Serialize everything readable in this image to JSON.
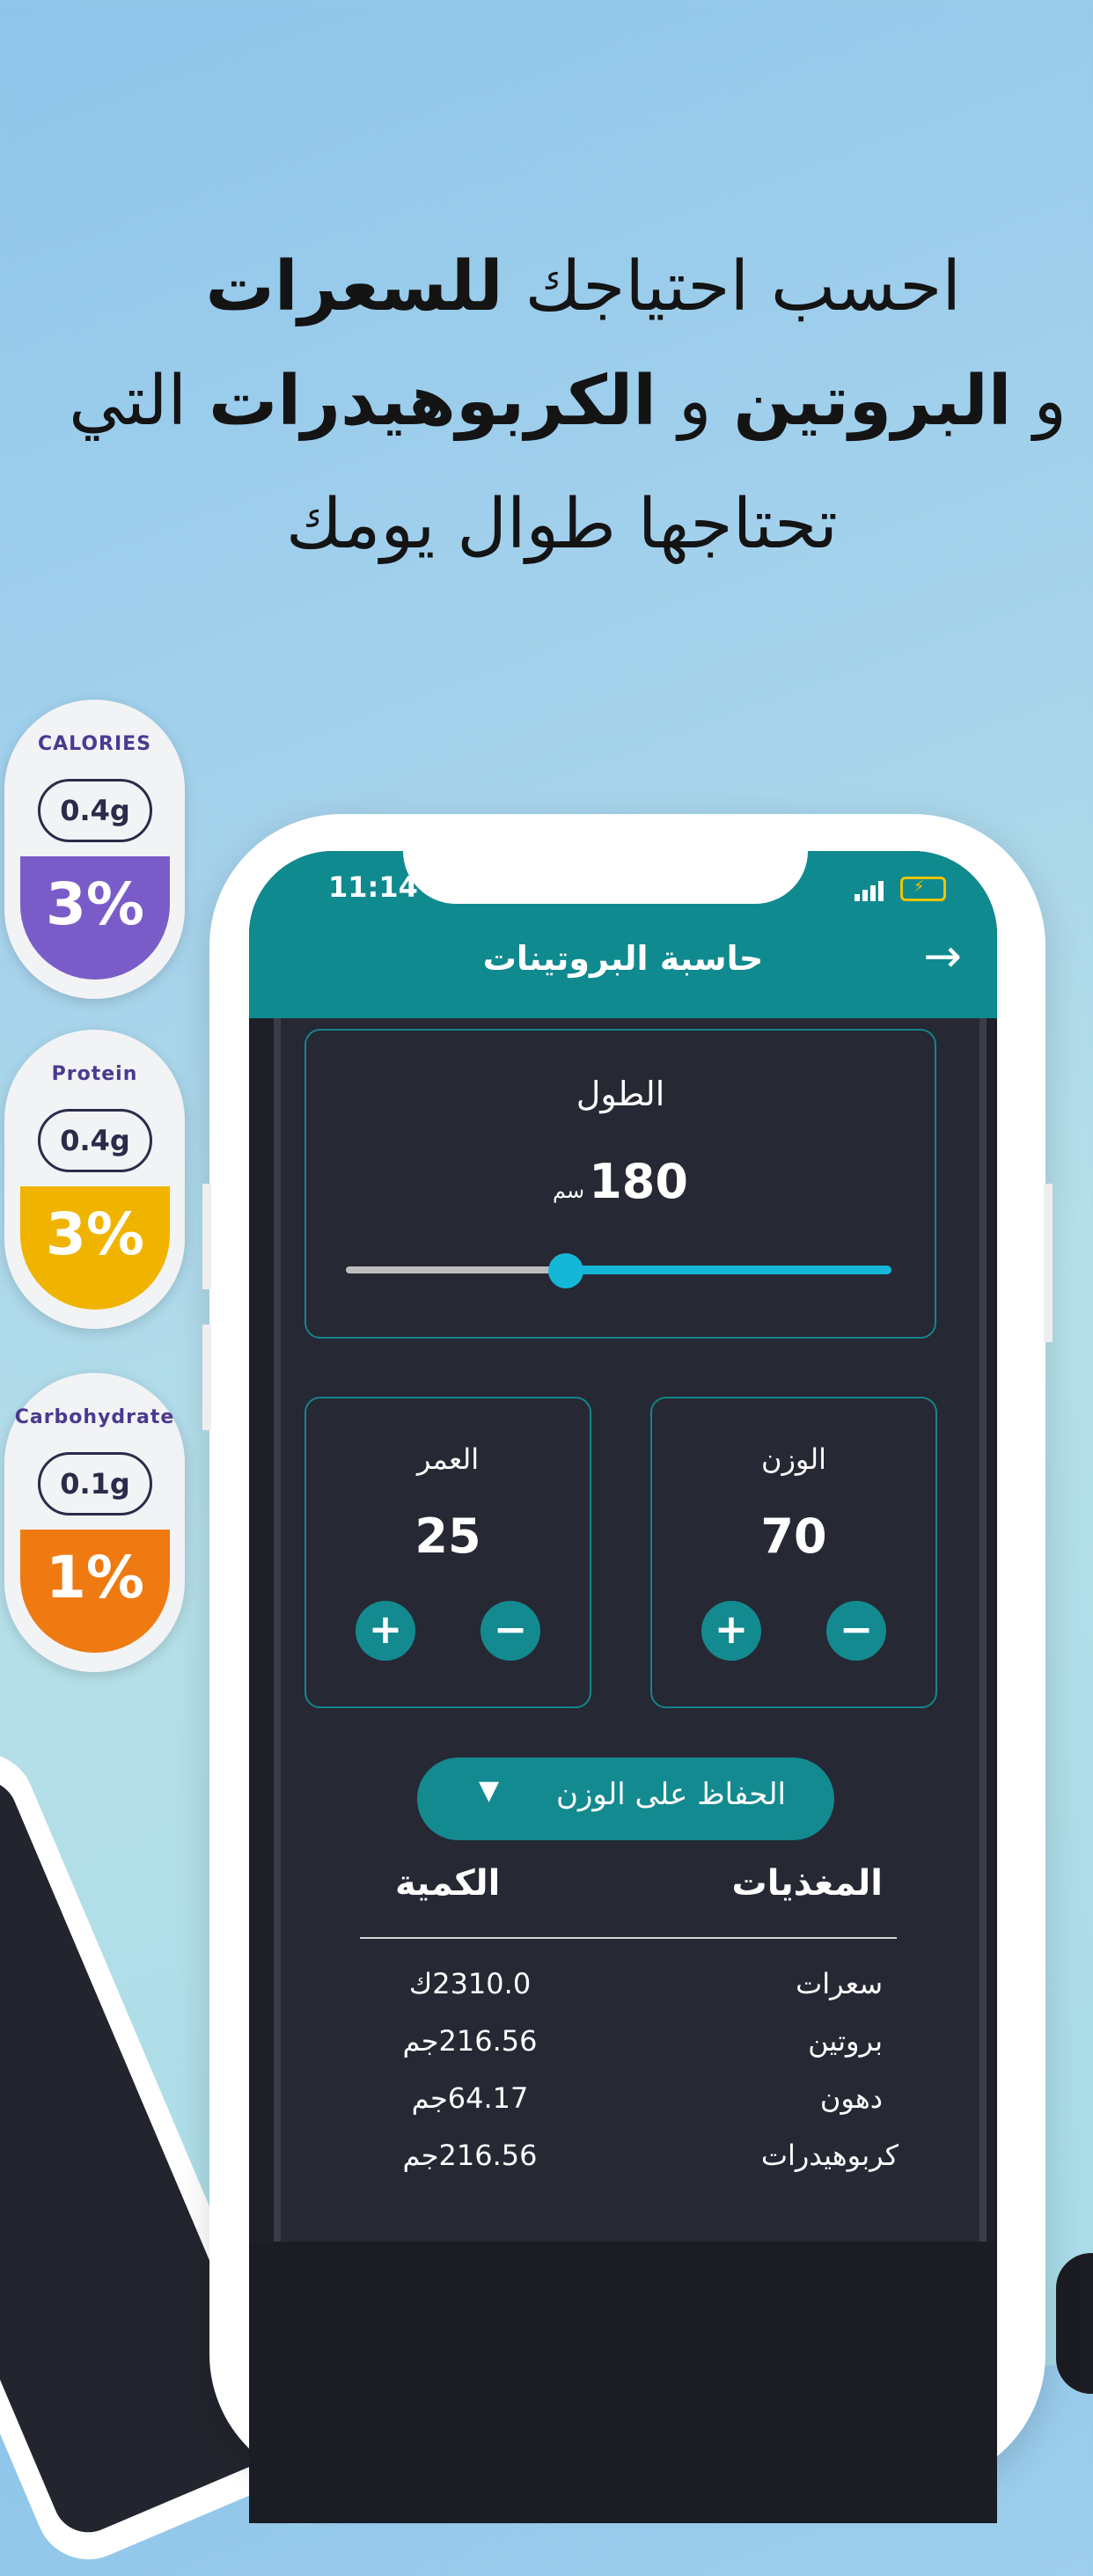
{
  "headline": {
    "line1_regular": "احسب احتياجك ",
    "line1_bold": "للسعرات",
    "line2_regular_a": "و ",
    "line2_bold_a": "البروتين",
    "line2_regular_b": " و ",
    "line2_bold_b": "الكربوهيدرات",
    "line2_regular_c": " التي",
    "line3": "تحتاجها طوال يومك"
  },
  "pills": [
    {
      "title": "CALORIES",
      "amount": "0.4g",
      "percent": "3%",
      "title_color": "#4b3a8f",
      "fill_color": "#7a5cc9"
    },
    {
      "title": "Protein",
      "amount": "0.4g",
      "percent": "3%",
      "title_color": "#4b3a8f",
      "fill_color": "#f0b400"
    },
    {
      "title": "Carbohydrate",
      "amount": "0.1g",
      "percent": "1%",
      "title_color": "#4b3a8f",
      "fill_color": "#ef7a12"
    }
  ],
  "status": {
    "time": "11:14"
  },
  "appbar": {
    "title": "حاسبة البروتينات",
    "back_icon": "arrow-right-icon"
  },
  "height_card": {
    "label": "الطول",
    "value": "180",
    "unit": "سم",
    "slider_fraction": 0.4
  },
  "weight_card": {
    "label": "الوزن",
    "value": "70"
  },
  "age_card": {
    "label": "العمر",
    "value": "25"
  },
  "goal_dropdown": {
    "selected": "الحفاظ على الوزن"
  },
  "table": {
    "headers": {
      "nutrients": "المغذيات",
      "amount": "الكمية"
    },
    "rows": [
      {
        "name": "سعرات",
        "value": "2310.0ك"
      },
      {
        "name": "بروتين",
        "value": "216.56جم"
      },
      {
        "name": "دهون",
        "value": "64.17جم"
      },
      {
        "name": "كربوهيدرات",
        "value": "216.56جم"
      }
    ]
  },
  "colors": {
    "accent": "#138a90",
    "slider": "#14b7d8",
    "screen_bg": "#262833"
  }
}
